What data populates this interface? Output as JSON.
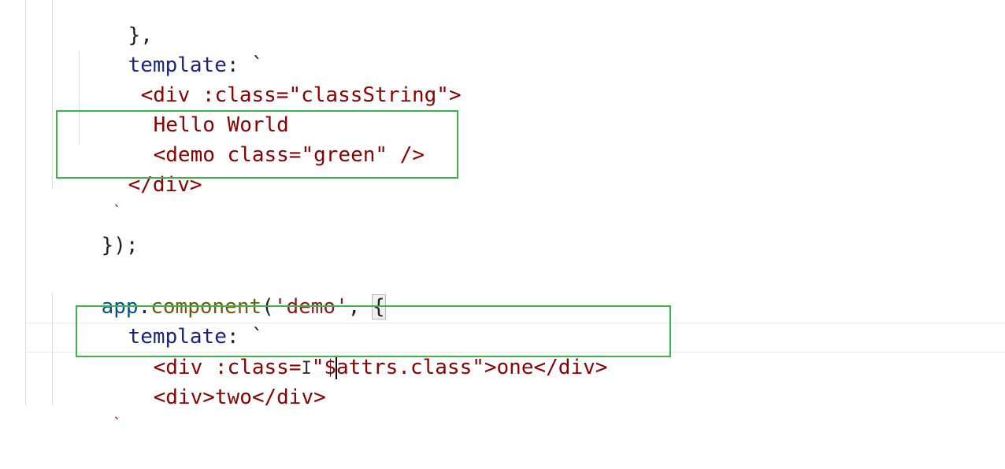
{
  "code": {
    "l0": "},",
    "l1_key": "template",
    "l1_rest": ": `",
    "l2": "<div :class=\"classString\">",
    "l3": "Hello World",
    "l4": "<demo class=\"green\" />",
    "l5": "</div>",
    "l6": "`",
    "l7": "});",
    "l8_obj": "app",
    "l8_dot": ".",
    "l8_fn": "component",
    "l8_open": "(",
    "l8_str": "'demo'",
    "l8_comma": ", ",
    "l8_brace": "{",
    "l9_key": "template",
    "l9_rest": ": `",
    "l10_a": "<div :class=",
    "l10_b": "\"",
    "l10_c": "$",
    "l10_d": "attrs.class\">one</div>",
    "l11": "<div>two</div>",
    "l12": "`"
  },
  "colors": {
    "highlight_box": "#3cb44b",
    "key": "#1a237e",
    "template_text": "#8b0000"
  }
}
